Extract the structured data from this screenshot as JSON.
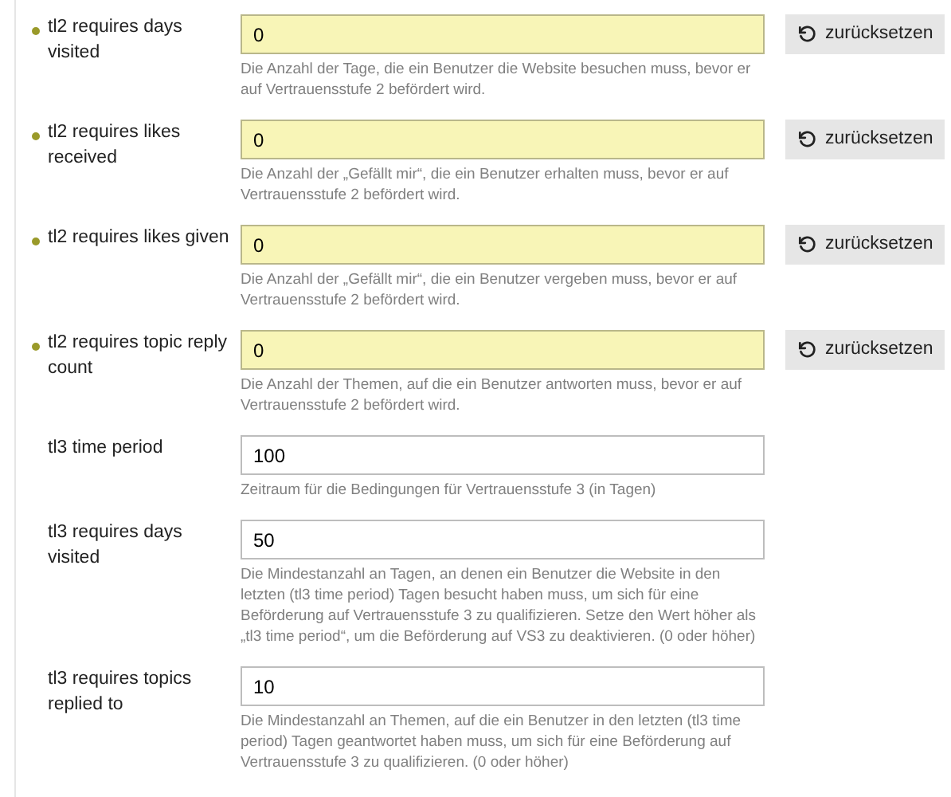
{
  "settings": [
    {
      "label": "tl2 requires days visited",
      "value": "0",
      "overridden": true,
      "description": "Die Anzahl der Tage, die ein Benutzer die Website besuchen muss, bevor er auf Vertrauensstufe 2 befördert wird.",
      "reset": "zurücksetzen"
    },
    {
      "label": "tl2 requires likes received",
      "value": "0",
      "overridden": true,
      "description": "Die Anzahl der „Gefällt mir“, die ein Benutzer erhalten muss, bevor er auf Vertrauensstufe 2 befördert wird.",
      "reset": "zurücksetzen"
    },
    {
      "label": "tl2 requires likes given",
      "value": "0",
      "overridden": true,
      "description": "Die Anzahl der „Gefällt mir“, die ein Benutzer vergeben muss, bevor er auf Vertrauensstufe 2 befördert wird.",
      "reset": "zurücksetzen"
    },
    {
      "label": "tl2 requires topic reply count",
      "value": "0",
      "overridden": true,
      "description": "Die Anzahl der Themen, auf die ein Benutzer antworten muss, bevor er auf Vertrauensstufe 2 befördert wird.",
      "reset": "zurücksetzen"
    },
    {
      "label": "tl3 time period",
      "value": "100",
      "overridden": false,
      "description": "Zeitraum für die Bedingungen für Vertrauensstufe 3 (in Tagen)"
    },
    {
      "label": "tl3 requires days visited",
      "value": "50",
      "overridden": false,
      "description": "Die Mindestanzahl an Tagen, an denen ein Benutzer die Website in den letzten (tl3 time period) Tagen besucht haben muss, um sich für eine Beförderung auf Vertrauensstufe 3 zu qualifizieren. Setze den Wert höher als „tl3 time period“, um die Beförderung auf VS3 zu deaktivieren. (0 oder höher)"
    },
    {
      "label": "tl3 requires topics replied to",
      "value": "10",
      "overridden": false,
      "description": "Die Mindestanzahl an Themen, auf die ein Benutzer in den letzten (tl3 time period) Tagen geantwortet haben muss, um sich für eine Beförderung auf Vertrauensstufe 3 zu qualifizieren. (0 oder höher)"
    }
  ]
}
